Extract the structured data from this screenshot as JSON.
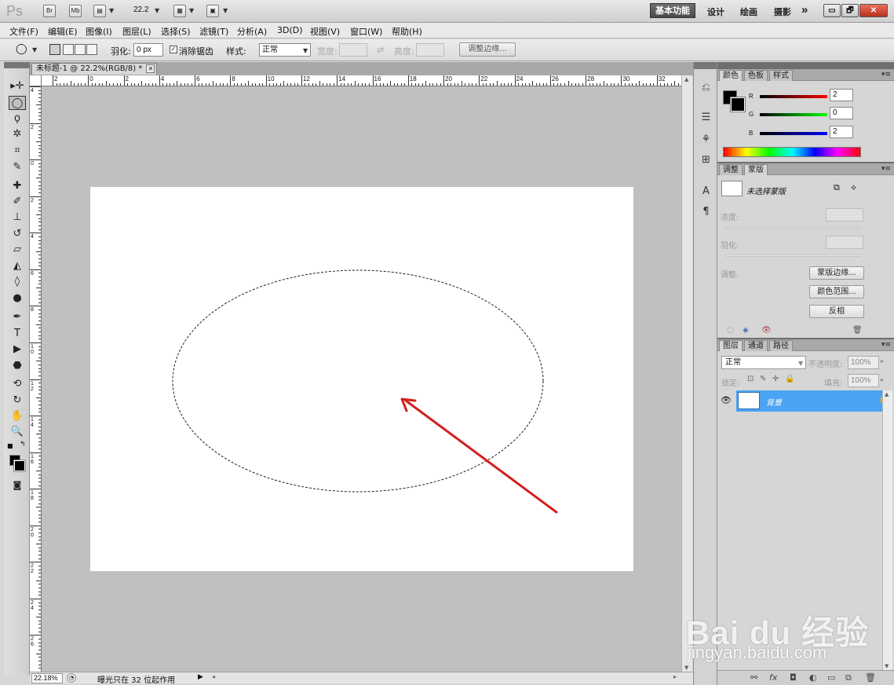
{
  "app": {
    "logo": "Ps",
    "bridge_btn": "Br",
    "minibridge_btn": "Mb",
    "zoom": "22.2",
    "workspaces": [
      "基本功能",
      "设计",
      "绘画",
      "摄影"
    ],
    "more": "»",
    "win_min": "▭",
    "win_max": "🗗",
    "win_close": "✕"
  },
  "menu": [
    "文件(F)",
    "编辑(E)",
    "图像(I)",
    "图层(L)",
    "选择(S)",
    "滤镜(T)",
    "分析(A)",
    "3D(D)",
    "视图(V)",
    "窗口(W)",
    "帮助(H)"
  ],
  "options": {
    "feather_label": "羽化:",
    "feather_value": "0 px",
    "antialias_label": "消除锯齿",
    "antialias_checked": true,
    "style_label": "样式:",
    "style_value": "正常",
    "width_label": "宽度:",
    "height_label": "高度:",
    "refine_edge": "调整边缘..."
  },
  "document": {
    "tab_title": "未标题-1 @ 22.2%(RGB/8) *",
    "close": "✕",
    "ruler_top": [
      "2",
      "0",
      "2",
      "4",
      "6",
      "8",
      "10",
      "12",
      "14",
      "16",
      "18",
      "20",
      "22",
      "24",
      "26",
      "28",
      "30",
      "32"
    ],
    "ruler_left": [
      "4",
      "2",
      "0",
      "2",
      "4",
      "6",
      "8",
      "10",
      "12",
      "14",
      "16",
      "18",
      "20",
      "22",
      "24",
      "26"
    ],
    "canvas_color": "#ffffff",
    "pasteboard_color": "#c0c0c0",
    "arrow_color": "#d42020"
  },
  "status": {
    "zoom": "22.18%",
    "message": "曝光只在 32 位起作用",
    "menu_arrow": "▶"
  },
  "panels": {
    "color": {
      "tabs": [
        "颜色",
        "色板",
        "样式"
      ],
      "r_label": "R",
      "r_value": "2",
      "g_label": "G",
      "g_value": "0",
      "b_label": "B",
      "b_value": "2"
    },
    "masks": {
      "tabs": [
        "调整",
        "蒙版"
      ],
      "no_mask": "未选择蒙版",
      "density": "浓度:",
      "feather": "羽化:",
      "refine": "调整:",
      "mask_edge_btn": "蒙版边缘...",
      "color_range_btn": "颜色范围...",
      "invert_btn": "反相"
    },
    "layers": {
      "tabs": [
        "图层",
        "通道",
        "路径"
      ],
      "blend_mode": "正常",
      "opacity_label": "不透明度:",
      "opacity_value": "100%",
      "lock_label": "锁定:",
      "fill_label": "填充:",
      "fill_value": "100%",
      "layer_name": "背景",
      "selected_color": "#4aa3f3"
    }
  },
  "watermark": {
    "brand": "Bai du 经验",
    "url": "jingyan.baidu.com"
  }
}
